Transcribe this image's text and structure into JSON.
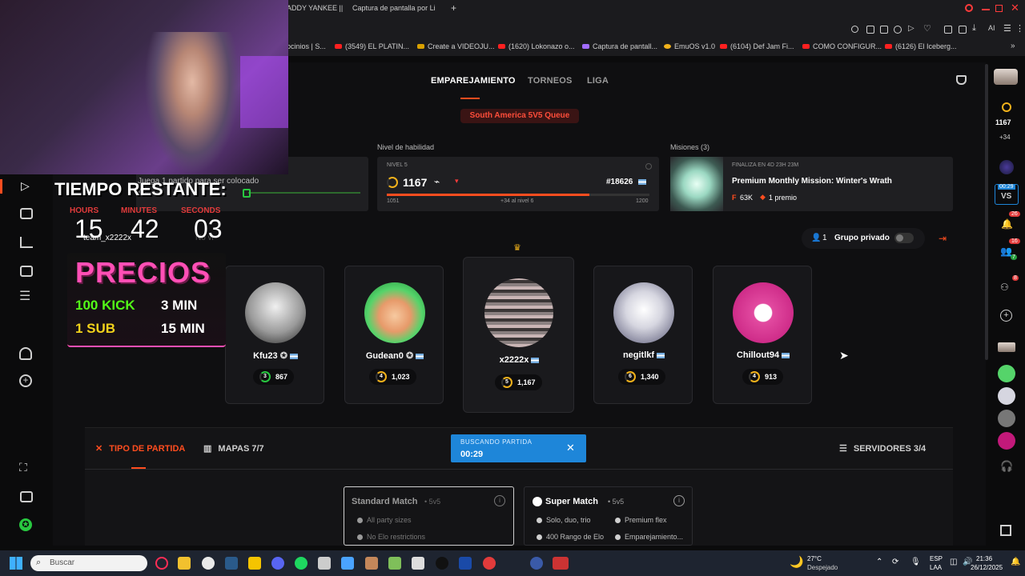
{
  "browser": {
    "tabs": [
      {
        "label": "ADDY YANKEE ||"
      },
      {
        "label": "Captura de pantalla por Li"
      }
    ],
    "bookmarks": [
      {
        "label": "ocinios | S..."
      },
      {
        "label": "(3549) EL PLATIN..."
      },
      {
        "label": "Create a VIDEOJU..."
      },
      {
        "label": "(1620) Lokonazo o..."
      },
      {
        "label": "Captura de pantall..."
      },
      {
        "label": "EmuOS v1.0"
      },
      {
        "label": "(6104) Def Jam Fi..."
      },
      {
        "label": "COMO CONFIGUR..."
      },
      {
        "label": "(6126) El Iceberg..."
      }
    ],
    "ai_label": "AI"
  },
  "nav": {
    "items": [
      "EMPAREJAMIENTO",
      "TORNEOS",
      "LIGA"
    ],
    "queue": "South America 5V5 Queue"
  },
  "left_panel": {
    "hint": "Juega 1 partido para ser colocado",
    "progress": "0/1",
    "username": "team_x2222x",
    "partial": "No vi"
  },
  "skill": {
    "section_label": "Nivel de habilidad",
    "level_label": "NIVEL 5",
    "elo": "1167",
    "rank": "#18626",
    "range_min": "1051",
    "range_note": "+34 al nivel 6",
    "range_max": "1200",
    "progress_pct": 77
  },
  "missions": {
    "section_label": "Misiones (3)",
    "ends": "FINALIZA EN 4D 23H 23M",
    "title": "Premium Monthly Mission: Winter's Wrath",
    "points": "63K",
    "prize": "1 premio"
  },
  "group": {
    "count": "1",
    "label": "Grupo privado"
  },
  "players": [
    {
      "name": "Kfu23",
      "level": "3",
      "elo": "867"
    },
    {
      "name": "Gudean0",
      "level": "4",
      "elo": "1,023"
    },
    {
      "name": "x2222x",
      "level": "5",
      "elo": "1,167"
    },
    {
      "name": "negitlkf",
      "level": "6",
      "elo": "1,340"
    },
    {
      "name": "Chillout94",
      "level": "4",
      "elo": "913"
    }
  ],
  "bottom_tabs": {
    "tipo": "TIPO DE PARTIDA",
    "mapas": "MAPAS 7/7",
    "servidores": "SERVIDORES 3/4"
  },
  "search": {
    "label": "BUSCANDO PARTIDA",
    "time": "00:29"
  },
  "matches": {
    "standard": {
      "title": "Standard Match",
      "mode": "• 5v5",
      "f1": "All party sizes",
      "f2": "No Elo restrictions"
    },
    "super": {
      "title": "Super Match",
      "mode": "• 5v5",
      "f1": "Solo, duo, trio",
      "f2": "Premium flex",
      "f3": "400 Rango de Elo",
      "f4": "Emparejamiento..."
    }
  },
  "right_rail": {
    "elo": "1167",
    "delta": "+34",
    "timer": "00:29",
    "vs": "VS",
    "notif_count": "26",
    "friends_count": "16",
    "friends_online": "7",
    "party_count": "8"
  },
  "overlay": {
    "timer_title": "TIEMPO RESTANTE:",
    "hours_label": "HOURS",
    "minutes_label": "MINUTES",
    "seconds_label": "SECONDS",
    "hours": "15",
    "minutes": "42",
    "seconds": "03",
    "precios": "PRECIOS",
    "kick_label": "100 KICK",
    "kick_time": "3 MIN",
    "sub_label": "1 SUB",
    "sub_time": "15 MIN"
  },
  "taskbar": {
    "search": "Buscar",
    "weather_temp": "27°C",
    "weather_desc": "Despejado",
    "lang": "ESP",
    "lang2": "LAA",
    "time": "21:36",
    "date": "26/12/2025"
  },
  "colors": {
    "accent": "#ff4d1f",
    "search_blue": "#1e86d9",
    "gold": "#f2b21b",
    "pink": "#ff4fb5"
  }
}
